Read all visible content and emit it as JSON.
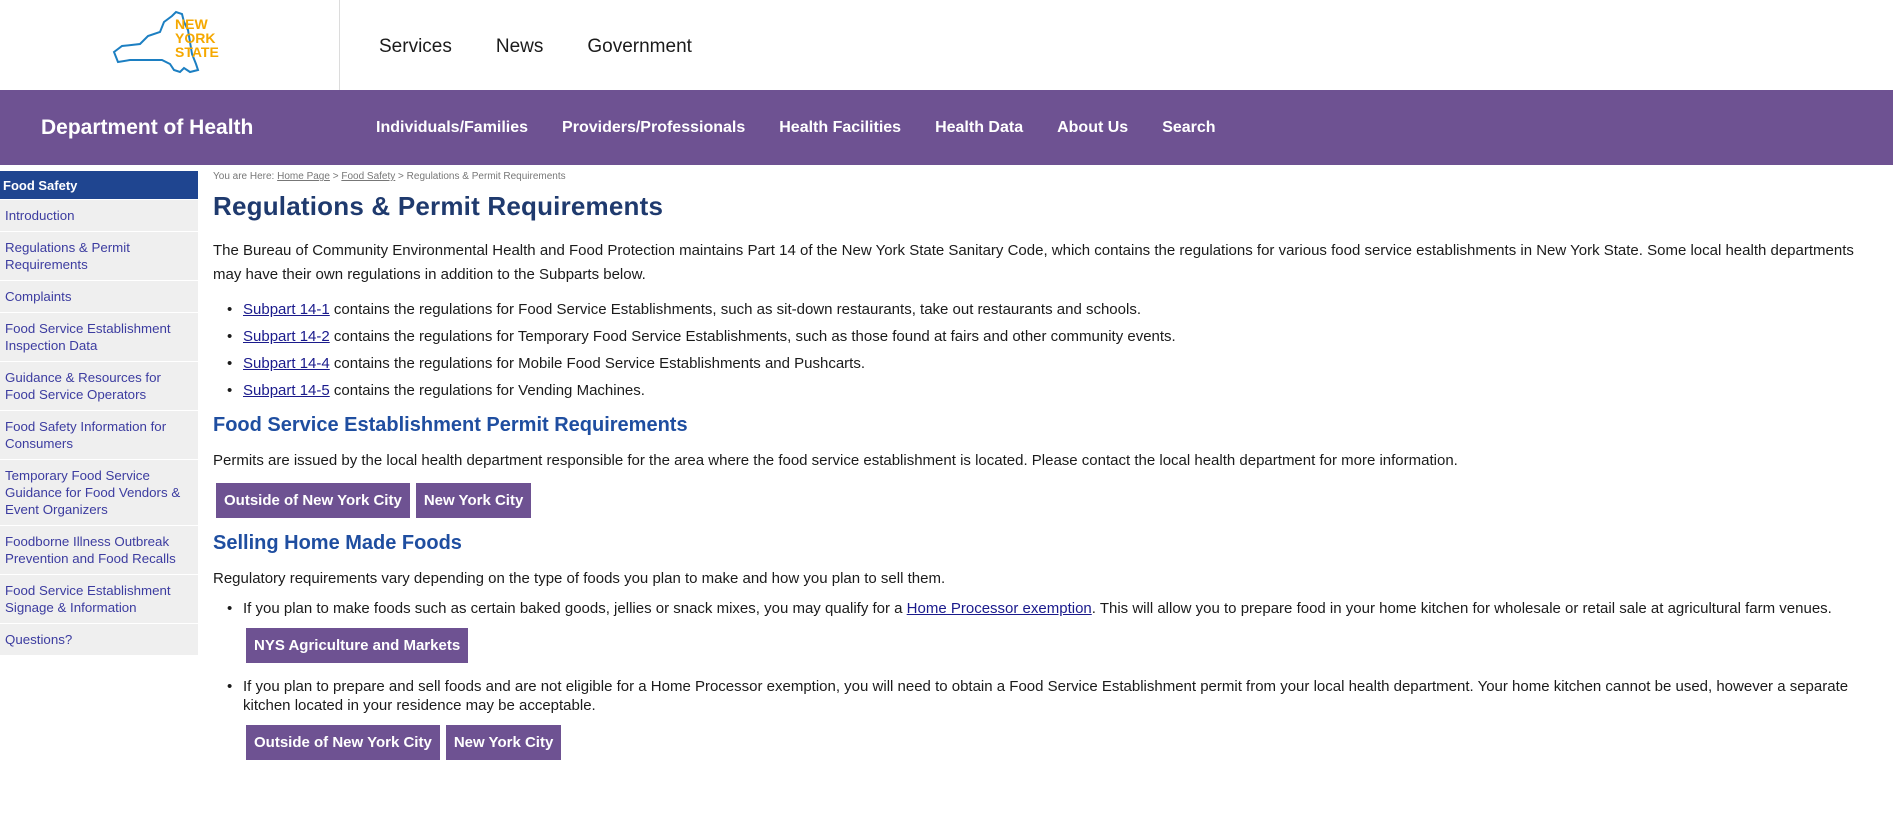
{
  "top_nav": {
    "logo_text": [
      "NEW",
      "YORK",
      "STATE"
    ],
    "items": [
      "Services",
      "News",
      "Government"
    ]
  },
  "agency": {
    "name": "Department of Health",
    "nav": [
      "Individuals/Families",
      "Providers/Professionals",
      "Health Facilities",
      "Health Data",
      "About Us",
      "Search"
    ]
  },
  "sidebar": {
    "heading": "Food Safety",
    "items": [
      "Introduction",
      "Regulations & Permit Requirements",
      "Complaints",
      "Food Service Establishment Inspection Data",
      "Guidance & Resources for Food Service Operators",
      "Food Safety Information for Consumers",
      "Temporary Food Service Guidance for Food Vendors & Event Organizers",
      "Foodborne Illness Outbreak Prevention and Food Recalls",
      "Food Service Establishment Signage & Information",
      "Questions?"
    ]
  },
  "breadcrumb": {
    "prefix": "You are Here: ",
    "home": "Home Page",
    "sep1": " > ",
    "food_safety": "Food Safety",
    "sep2": " > ",
    "current": "Regulations & Permit Requirements"
  },
  "page": {
    "title": "Regulations & Permit Requirements",
    "intro": "The Bureau of Community Environmental Health and Food Protection maintains Part 14 of the New York State Sanitary Code, which contains the regulations for various food service establishments in New York State. Some local health departments may have their own regulations in addition to the Subparts below.",
    "subparts": [
      {
        "link": "Subpart 14-1",
        "text": " contains the regulations for Food Service Establishments, such as sit-down restaurants, take out restaurants and schools."
      },
      {
        "link": "Subpart 14-2",
        "text": " contains the regulations for Temporary Food Service Establishments, such as those found at fairs and other community events."
      },
      {
        "link": "Subpart 14-4",
        "text": " contains the regulations for Mobile Food Service Establishments and Pushcarts."
      },
      {
        "link": "Subpart 14-5",
        "text": " contains the regulations for Vending Machines."
      }
    ],
    "permits_heading": "Food Service Establishment Permit Requirements",
    "permits_text": "Permits are issued by the local health department responsible for the area where the food service establishment is located. Please contact the local health department for more information.",
    "btn_outside": "Outside of New York City",
    "btn_nyc": "New York City",
    "selling_heading": "Selling Home Made Foods",
    "selling_text": "Regulatory requirements vary depending on the type of foods you plan to make and how you plan to sell them.",
    "home_item1_pre": "If you plan to make foods such as certain baked goods, jellies or snack mixes, you may qualify for a ",
    "home_item1_link": "Home Processor exemption",
    "home_item1_post": ". This will allow you to prepare food in your home kitchen for wholesale or retail sale at agricultural farm venues.",
    "btn_agriculture": "NYS Agriculture and Markets",
    "home_item2": "If you plan to prepare and sell foods and are not eligible for a Home Processor exemption, you will need to obtain a Food Service Establishment permit from your local health department. Your home kitchen cannot be used, however a separate kitchen located in your residence may be acceptable.",
    "btn_outside2": "Outside of New York City",
    "btn_nyc2": "New York City"
  },
  "colors": {
    "purple": "#6e5292",
    "sidebar_head": "#1f4590",
    "heading_blue": "#1f4ea0",
    "logo_gold": "#f5a800",
    "logo_blue": "#1c7fc2"
  }
}
